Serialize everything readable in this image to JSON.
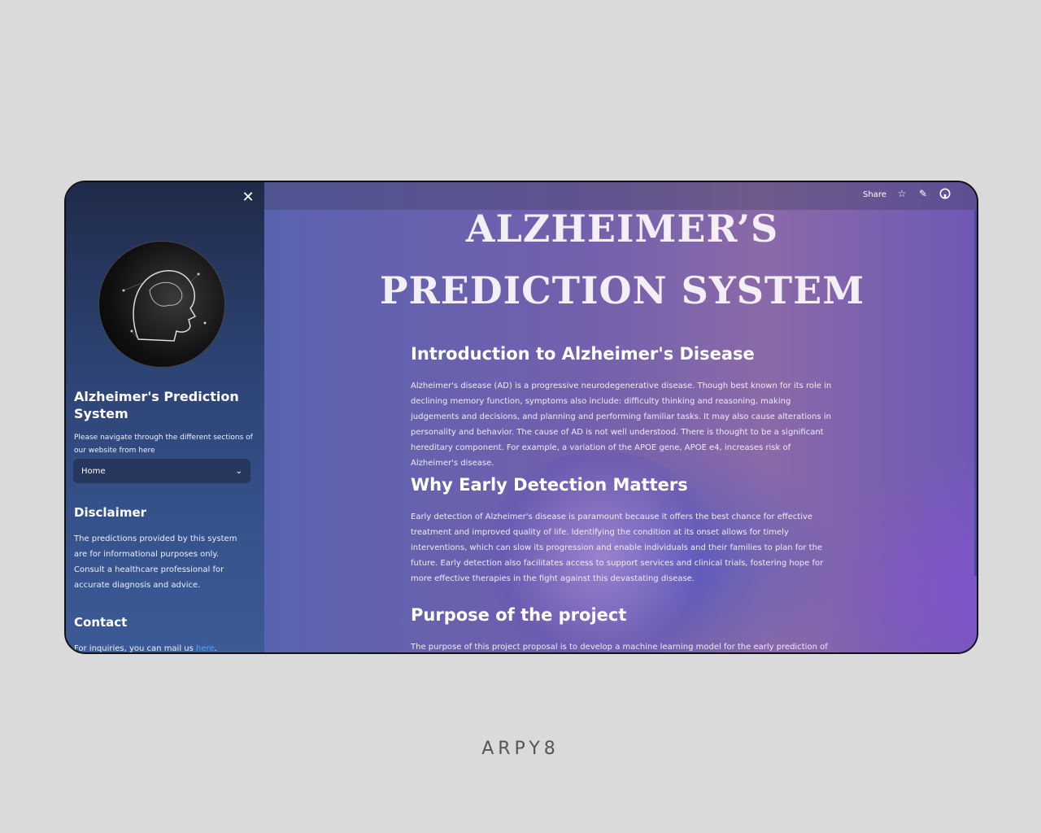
{
  "sidebar": {
    "close_icon": "close-icon",
    "title": "Alzheimer's Prediction System",
    "nav_hint": "Please navigate through the different sections of our website from here",
    "select_value": "Home",
    "disclaimer_heading": "Disclaimer",
    "disclaimer_text": "The predictions provided by this system are for informational purposes only. Consult a healthcare professional for accurate diagnosis and advice.",
    "contact_heading": "Contact",
    "contact_text": "For inquiries, you can mail us ",
    "contact_link": "here",
    "contact_end": "."
  },
  "topbar": {
    "share_label": "Share"
  },
  "main": {
    "hero_line1": "ALZHEIMER’S",
    "hero_line2": "PREDICTION SYSTEM",
    "intro_heading": "Introduction to Alzheimer's Disease",
    "intro_text": "Alzheimer's disease (AD) is a progressive neurodegenerative disease. Though best known for its role in declining memory function, symptoms also include: difficulty thinking and reasoning, making judgements and decisions, and planning and performing familiar tasks. It may also cause alterations in personality and behavior. The cause of AD is not well understood. There is thought to be a significant hereditary component. For example, a variation of the APOE gene, APOE e4, increases risk of Alzheimer's disease.",
    "early_heading": "Why Early Detection Matters",
    "early_text": "Early detection of Alzheimer's disease is paramount because it offers the best chance for effective treatment and improved quality of life. Identifying the condition at its onset allows for timely interventions, which can slow its progression and enable individuals and their families to plan for the future. Early detection also facilitates access to support services and clinical trials, fostering hope for more effective therapies in the fight against this devastating disease.",
    "purpose_heading": "Purpose of the project",
    "purpose_text": "The purpose of this project proposal is to develop a machine learning model for the early prediction of"
  },
  "footer_brand": "ARPY8"
}
